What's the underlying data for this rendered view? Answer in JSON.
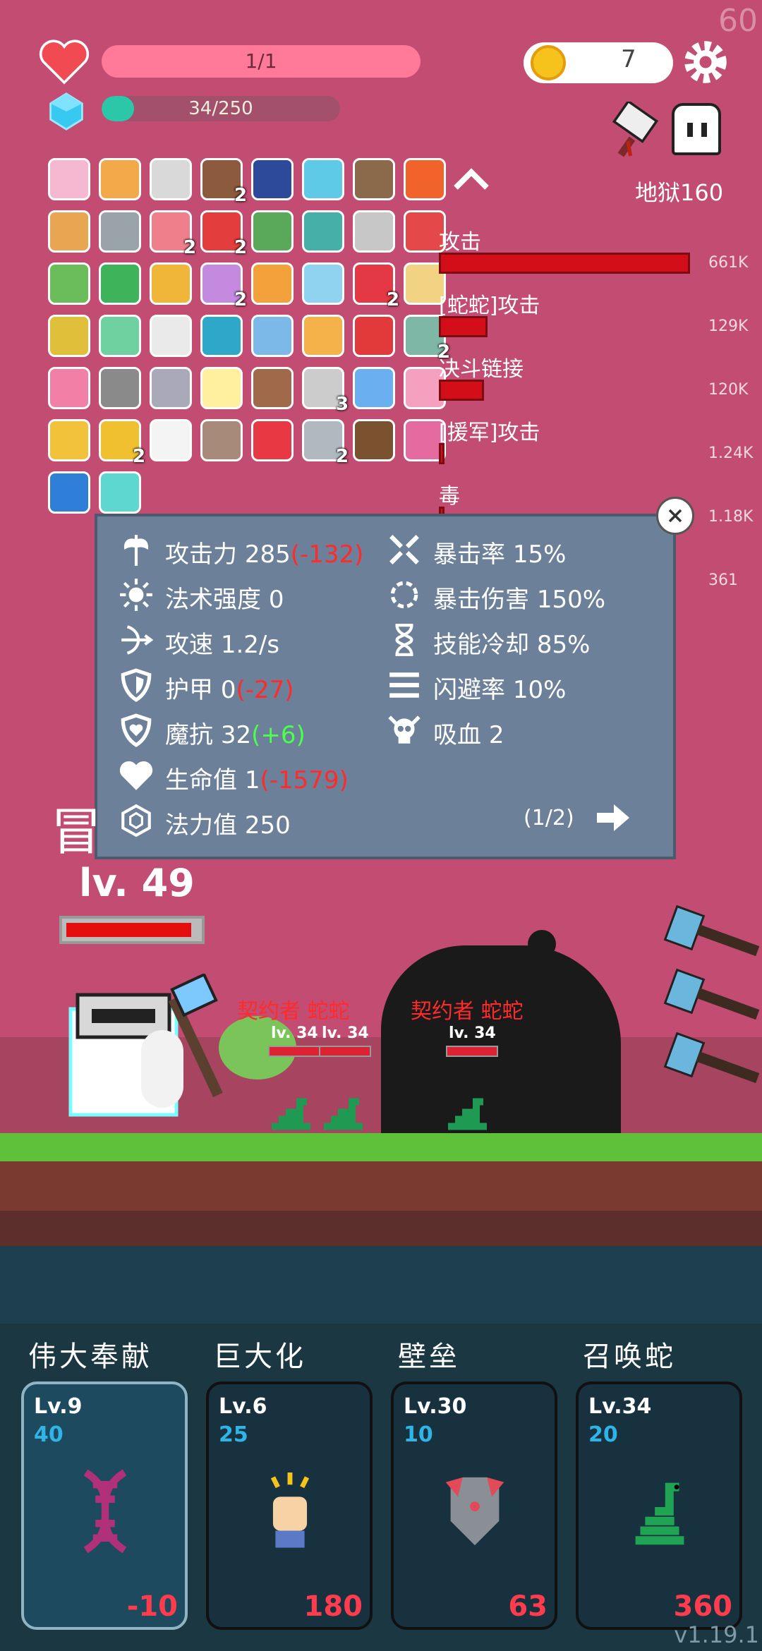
{
  "fps": "60",
  "player": {
    "hp_text": "1/1",
    "mana_text": "34/250",
    "mana_fraction": 0.136,
    "gold": "7",
    "stage": "地狱160",
    "level": "lv. 49",
    "hp_fraction": 0.97
  },
  "items": [
    {
      "icon": "envelope-icon"
    },
    {
      "icon": "scroll-icon"
    },
    {
      "icon": "tools-icon"
    },
    {
      "icon": "pudding-icon",
      "count": "2"
    },
    {
      "icon": "bible-icon"
    },
    {
      "icon": "magnifier-icon"
    },
    {
      "icon": "pirate-ship-icon"
    },
    {
      "icon": "fire-spirit-icon"
    },
    {
      "icon": "book-icon"
    },
    {
      "icon": "spiked-mace-icon"
    },
    {
      "icon": "meat-icon",
      "count": "2"
    },
    {
      "icon": "sock-icon",
      "count": "2"
    },
    {
      "icon": "tea-cup-icon"
    },
    {
      "icon": "tent-icon"
    },
    {
      "icon": "molecule-icon"
    },
    {
      "icon": "watermelon-icon"
    },
    {
      "icon": "money-icon"
    },
    {
      "icon": "green-card-icon"
    },
    {
      "icon": "pineapple-icon"
    },
    {
      "icon": "flower-pot-icon",
      "count": "2"
    },
    {
      "icon": "crown-icon"
    },
    {
      "icon": "potion-icon"
    },
    {
      "icon": "heart-icon",
      "count": "2"
    },
    {
      "icon": "treasure-map-icon"
    },
    {
      "icon": "egg-icon"
    },
    {
      "icon": "beads-icon"
    },
    {
      "icon": "cards-icon"
    },
    {
      "icon": "spiral-icon"
    },
    {
      "icon": "robe-icon"
    },
    {
      "icon": "id-card-icon"
    },
    {
      "icon": "apple-icon"
    },
    {
      "icon": "disc-icon",
      "count": "2"
    },
    {
      "icon": "spray-bottle-icon"
    },
    {
      "icon": "meteor-icon"
    },
    {
      "icon": "battle-axe-icon"
    },
    {
      "icon": "daisy-icon"
    },
    {
      "icon": "round-shield-icon"
    },
    {
      "icon": "spiked-club-icon",
      "count": "3"
    },
    {
      "icon": "feather-pen-icon"
    },
    {
      "icon": "ice-cream-icon"
    },
    {
      "icon": "beer-icon"
    },
    {
      "icon": "coins-icon",
      "count": "2"
    },
    {
      "icon": "ghost-icon"
    },
    {
      "icon": "tombstone-icon"
    },
    {
      "icon": "bookmark-icon"
    },
    {
      "icon": "sword-icon",
      "count": "2"
    },
    {
      "icon": "coconut-icon"
    },
    {
      "icon": "hook-icon"
    },
    {
      "icon": "star-card-icon"
    },
    {
      "icon": "glow-card-icon"
    }
  ],
  "damage_list": [
    {
      "label": "攻击",
      "value": "661K",
      "fraction": 1.0
    },
    {
      "label": "[蛇蛇]攻击",
      "value": "129K",
      "fraction": 0.195
    },
    {
      "label": "决斗链接",
      "value": "120K",
      "fraction": 0.18
    },
    {
      "label": "[援军]攻击",
      "value": "1.24K",
      "fraction": 0.02
    },
    {
      "label": "毒",
      "value": "1.18K",
      "fraction": 0.02
    },
    {
      "label": "",
      "value": "361",
      "fraction": 0.005
    }
  ],
  "stats": {
    "attack_label": "攻击力",
    "attack_value": "285",
    "attack_mod": "(-132)",
    "spell_label": "法术强度",
    "spell_value": "0",
    "speed_label": "攻速",
    "speed_value": "1.2/s",
    "armor_label": "护甲",
    "armor_value": "0",
    "armor_mod": "(-27)",
    "resist_label": "魔抗",
    "resist_value": "32",
    "resist_mod": "(+6)",
    "hp_label": "生命值",
    "hp_value": "1",
    "hp_mod": "(-1579)",
    "mana_label": "法力值",
    "mana_value": "250",
    "crit_label": "暴击率",
    "crit_value": "15%",
    "critdmg_label": "暴击伤害",
    "critdmg_value": "150%",
    "cooldown_label": "技能冷却",
    "cooldown_value": "85%",
    "dodge_label": "闪避率",
    "dodge_value": "10%",
    "lifesteal_label": "吸血",
    "lifesteal_value": "2",
    "page": "(1/2)"
  },
  "enemies": [
    {
      "name": "契约者 蛇蛇",
      "levels": [
        "lv. 34",
        "lv. 34"
      ]
    },
    {
      "name": "契约者 蛇蛇",
      "levels": [
        "lv. 34"
      ]
    }
  ],
  "skills": [
    {
      "name": "伟大奉献",
      "level": "Lv.9",
      "cost": "40",
      "value": "-10",
      "icon": "dna-icon"
    },
    {
      "name": "巨大化",
      "level": "Lv.6",
      "cost": "25",
      "value": "180",
      "icon": "fist-icon"
    },
    {
      "name": "壁垒",
      "level": "Lv.30",
      "cost": "10",
      "value": "63",
      "icon": "armor-icon"
    },
    {
      "name": "召唤蛇",
      "level": "Lv.34",
      "cost": "20",
      "value": "360",
      "icon": "snake-icon"
    }
  ],
  "version": "v1.19.1",
  "colors": {
    "background": "#c24c72",
    "panel": "#6c8099",
    "damage_bar": "#d30e18",
    "negative": "#ff2a2a",
    "positive": "#4cff4c",
    "skill_cost": "#2fb4e8"
  }
}
